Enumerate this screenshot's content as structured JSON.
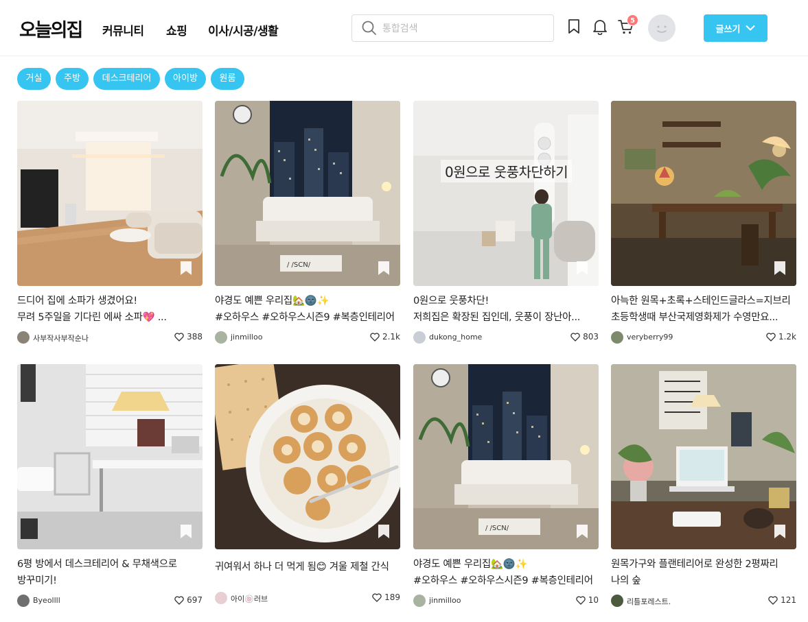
{
  "header": {
    "logo": "오늘의집",
    "nav": [
      "커뮤니티",
      "쇼핑",
      "이사/시공/생활"
    ],
    "search_placeholder": "통합검색",
    "cart_count": "5",
    "write_label": "글쓰기"
  },
  "categories": [
    "거실",
    "주방",
    "데스크테리어",
    "아이방",
    "원룸"
  ],
  "cards": [
    {
      "overlay": "",
      "title_line1": "드디어 집에 소파가 생겼어요!",
      "title_line2": "무려 5주일을 기다린 에싸 소파💖 ...",
      "author": "사부작사부작순나",
      "likes": "388"
    },
    {
      "overlay": "",
      "title_line1": "야경도 예쁜 우리집🏡🌚✨",
      "title_line2": "#오하우스 #오하우스시즌9 #복층인테리어",
      "author": "jinmilloo",
      "likes": "2.1k"
    },
    {
      "overlay": "0원으로 웃풍차단하기",
      "title_line1": "0원으로 웃풍차단!",
      "title_line2": " 저희집은 확장된 집인데, 웃풍이 장난아...",
      "author": "dukong_home",
      "likes": "803"
    },
    {
      "overlay": "",
      "title_line1": "아늑한 원목+초록+스테인드글라스=지브리",
      "title_line2": " 초등학생때 부산국제영화제가 수영만요...",
      "author": "veryberry99",
      "likes": "1.2k"
    },
    {
      "overlay": "",
      "title_line1": "6평 방에서 데스크테리어 & 무채색으로",
      "title_line2": "방꾸미기!",
      "author": "Byeollll",
      "likes": "697"
    },
    {
      "overlay": "",
      "title_line1": "귀여워서 하나 더 먹게 됨😊 겨울 제철 간식",
      "title_line2": "",
      "author": "아이🍥러브",
      "likes": "189"
    },
    {
      "overlay": "",
      "title_line1": "야경도 예쁜 우리집🏡🌚✨",
      "title_line2": "#오하우스 #오하우스시즌9 #복층인테리어",
      "author": "jinmilloo",
      "likes": "10"
    },
    {
      "overlay": "",
      "title_line1": "원목가구와 플랜테리어로 완성한 2평짜리",
      "title_line2": "나의 숲",
      "author": "리틀포레스트.",
      "likes": "121"
    }
  ],
  "colors": {
    "accent": "#35c5f0",
    "badge": "#ff7777"
  }
}
